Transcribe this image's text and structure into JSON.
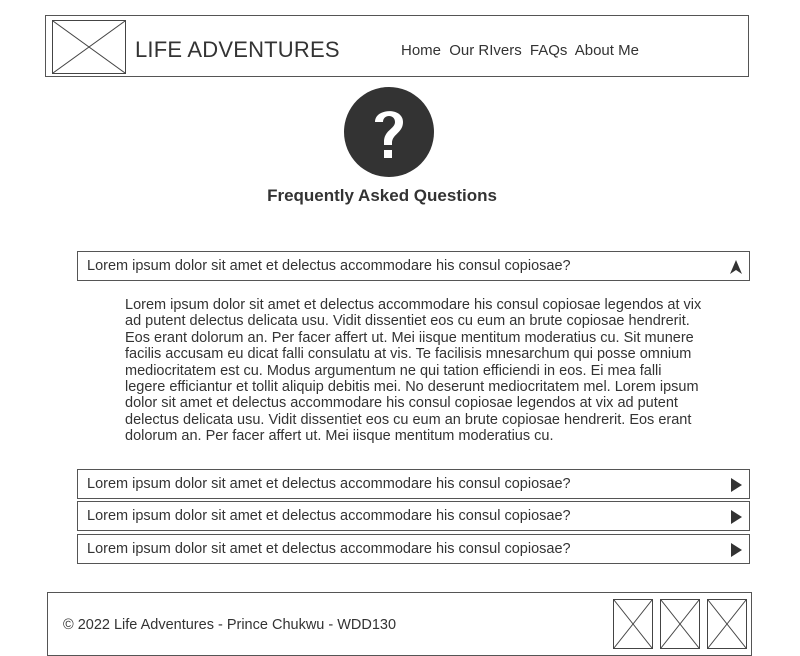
{
  "header": {
    "brand": "LIFE ADVENTURES",
    "nav": [
      "Home",
      "Our RIvers",
      "FAQs",
      "About Me"
    ]
  },
  "main": {
    "icon": "question-mark-icon",
    "title": "Frequently Asked Questions",
    "faqs": [
      {
        "question": "Lorem ipsum dolor sit amet et delectus accommodare his consul copiosae?",
        "expanded": true,
        "answer": "Lorem ipsum dolor sit amet et delectus accommodare his consul copiosae legendos at vix ad putent delectus delicata usu. Vidit dissentiet eos cu eum an brute copiosae hendrerit. Eos erant dolorum an. Per facer affert ut. Mei iisque mentitum moderatius cu. Sit munere facilis accusam eu dicat falli consulatu at vis. Te facilisis mnesarchum qui posse omnium mediocritatem est cu. Modus argumentum ne qui tation efficiendi in eos. Ei mea falli legere efficiantur et tollit aliquip debitis mei. No deserunt mediocritatem mel. Lorem ipsum dolor sit amet et delectus accommodare his consul copiosae legendos at vix ad putent delectus delicata usu. Vidit dissentiet eos cu eum an brute copiosae hendrerit. Eos erant dolorum an. Per facer affert ut. Mei iisque mentitum moderatius cu."
      },
      {
        "question": "Lorem ipsum dolor sit amet et delectus accommodare his consul copiosae?",
        "expanded": false
      },
      {
        "question": "Lorem ipsum dolor sit amet et delectus accommodare his consul copiosae?",
        "expanded": false
      },
      {
        "question": "Lorem ipsum dolor sit amet et delectus accommodare his consul copiosae?",
        "expanded": false
      }
    ]
  },
  "footer": {
    "copyright": "© 2022 Life Adventures - Prince Chukwu - WDD130"
  },
  "colors": {
    "text": "#333333",
    "border": "#555555",
    "icon": "#333333"
  }
}
